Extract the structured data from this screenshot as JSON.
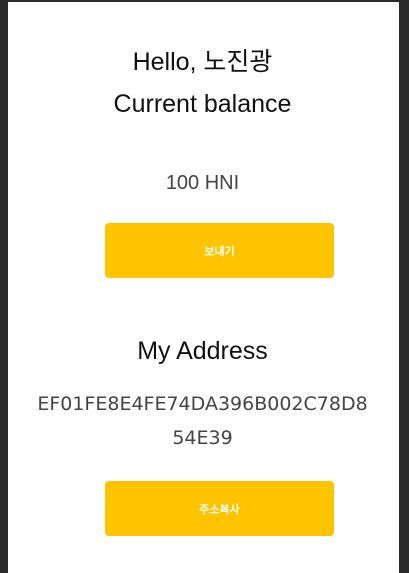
{
  "greeting": "Hello, 노진광",
  "balance_label": "Current balance",
  "balance_value": "100 HNI",
  "send_button": {
    "label": "보내기"
  },
  "address_title": "My Address",
  "address_value": "EF01FE8E4FE74DA396B002C78D854E39",
  "copy_button": {
    "label": "주소복사"
  },
  "colors": {
    "accent": "#ffc400",
    "frame": "#2a2a2a",
    "text": "#111111",
    "muted_text": "#444444"
  }
}
